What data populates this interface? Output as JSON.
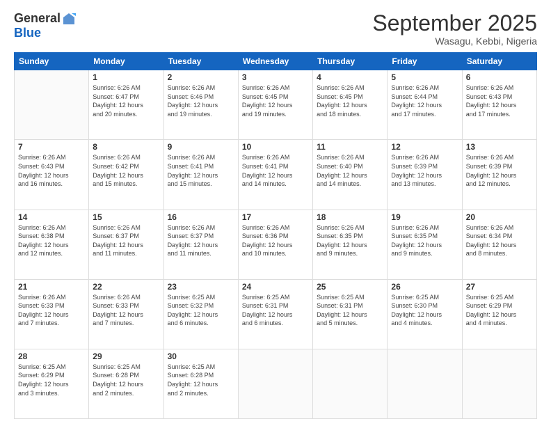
{
  "header": {
    "logo": {
      "general": "General",
      "blue": "Blue"
    },
    "title": "September 2025",
    "location": "Wasagu, Kebbi, Nigeria"
  },
  "weekdays": [
    "Sunday",
    "Monday",
    "Tuesday",
    "Wednesday",
    "Thursday",
    "Friday",
    "Saturday"
  ],
  "weeks": [
    [
      {
        "day": "",
        "info": ""
      },
      {
        "day": "1",
        "info": "Sunrise: 6:26 AM\nSunset: 6:47 PM\nDaylight: 12 hours\nand 20 minutes."
      },
      {
        "day": "2",
        "info": "Sunrise: 6:26 AM\nSunset: 6:46 PM\nDaylight: 12 hours\nand 19 minutes."
      },
      {
        "day": "3",
        "info": "Sunrise: 6:26 AM\nSunset: 6:45 PM\nDaylight: 12 hours\nand 19 minutes."
      },
      {
        "day": "4",
        "info": "Sunrise: 6:26 AM\nSunset: 6:45 PM\nDaylight: 12 hours\nand 18 minutes."
      },
      {
        "day": "5",
        "info": "Sunrise: 6:26 AM\nSunset: 6:44 PM\nDaylight: 12 hours\nand 17 minutes."
      },
      {
        "day": "6",
        "info": "Sunrise: 6:26 AM\nSunset: 6:43 PM\nDaylight: 12 hours\nand 17 minutes."
      }
    ],
    [
      {
        "day": "7",
        "info": "Sunrise: 6:26 AM\nSunset: 6:43 PM\nDaylight: 12 hours\nand 16 minutes."
      },
      {
        "day": "8",
        "info": "Sunrise: 6:26 AM\nSunset: 6:42 PM\nDaylight: 12 hours\nand 15 minutes."
      },
      {
        "day": "9",
        "info": "Sunrise: 6:26 AM\nSunset: 6:41 PM\nDaylight: 12 hours\nand 15 minutes."
      },
      {
        "day": "10",
        "info": "Sunrise: 6:26 AM\nSunset: 6:41 PM\nDaylight: 12 hours\nand 14 minutes."
      },
      {
        "day": "11",
        "info": "Sunrise: 6:26 AM\nSunset: 6:40 PM\nDaylight: 12 hours\nand 14 minutes."
      },
      {
        "day": "12",
        "info": "Sunrise: 6:26 AM\nSunset: 6:39 PM\nDaylight: 12 hours\nand 13 minutes."
      },
      {
        "day": "13",
        "info": "Sunrise: 6:26 AM\nSunset: 6:39 PM\nDaylight: 12 hours\nand 12 minutes."
      }
    ],
    [
      {
        "day": "14",
        "info": "Sunrise: 6:26 AM\nSunset: 6:38 PM\nDaylight: 12 hours\nand 12 minutes."
      },
      {
        "day": "15",
        "info": "Sunrise: 6:26 AM\nSunset: 6:37 PM\nDaylight: 12 hours\nand 11 minutes."
      },
      {
        "day": "16",
        "info": "Sunrise: 6:26 AM\nSunset: 6:37 PM\nDaylight: 12 hours\nand 11 minutes."
      },
      {
        "day": "17",
        "info": "Sunrise: 6:26 AM\nSunset: 6:36 PM\nDaylight: 12 hours\nand 10 minutes."
      },
      {
        "day": "18",
        "info": "Sunrise: 6:26 AM\nSunset: 6:35 PM\nDaylight: 12 hours\nand 9 minutes."
      },
      {
        "day": "19",
        "info": "Sunrise: 6:26 AM\nSunset: 6:35 PM\nDaylight: 12 hours\nand 9 minutes."
      },
      {
        "day": "20",
        "info": "Sunrise: 6:26 AM\nSunset: 6:34 PM\nDaylight: 12 hours\nand 8 minutes."
      }
    ],
    [
      {
        "day": "21",
        "info": "Sunrise: 6:26 AM\nSunset: 6:33 PM\nDaylight: 12 hours\nand 7 minutes."
      },
      {
        "day": "22",
        "info": "Sunrise: 6:26 AM\nSunset: 6:33 PM\nDaylight: 12 hours\nand 7 minutes."
      },
      {
        "day": "23",
        "info": "Sunrise: 6:25 AM\nSunset: 6:32 PM\nDaylight: 12 hours\nand 6 minutes."
      },
      {
        "day": "24",
        "info": "Sunrise: 6:25 AM\nSunset: 6:31 PM\nDaylight: 12 hours\nand 6 minutes."
      },
      {
        "day": "25",
        "info": "Sunrise: 6:25 AM\nSunset: 6:31 PM\nDaylight: 12 hours\nand 5 minutes."
      },
      {
        "day": "26",
        "info": "Sunrise: 6:25 AM\nSunset: 6:30 PM\nDaylight: 12 hours\nand 4 minutes."
      },
      {
        "day": "27",
        "info": "Sunrise: 6:25 AM\nSunset: 6:29 PM\nDaylight: 12 hours\nand 4 minutes."
      }
    ],
    [
      {
        "day": "28",
        "info": "Sunrise: 6:25 AM\nSunset: 6:29 PM\nDaylight: 12 hours\nand 3 minutes."
      },
      {
        "day": "29",
        "info": "Sunrise: 6:25 AM\nSunset: 6:28 PM\nDaylight: 12 hours\nand 2 minutes."
      },
      {
        "day": "30",
        "info": "Sunrise: 6:25 AM\nSunset: 6:28 PM\nDaylight: 12 hours\nand 2 minutes."
      },
      {
        "day": "",
        "info": ""
      },
      {
        "day": "",
        "info": ""
      },
      {
        "day": "",
        "info": ""
      },
      {
        "day": "",
        "info": ""
      }
    ]
  ]
}
